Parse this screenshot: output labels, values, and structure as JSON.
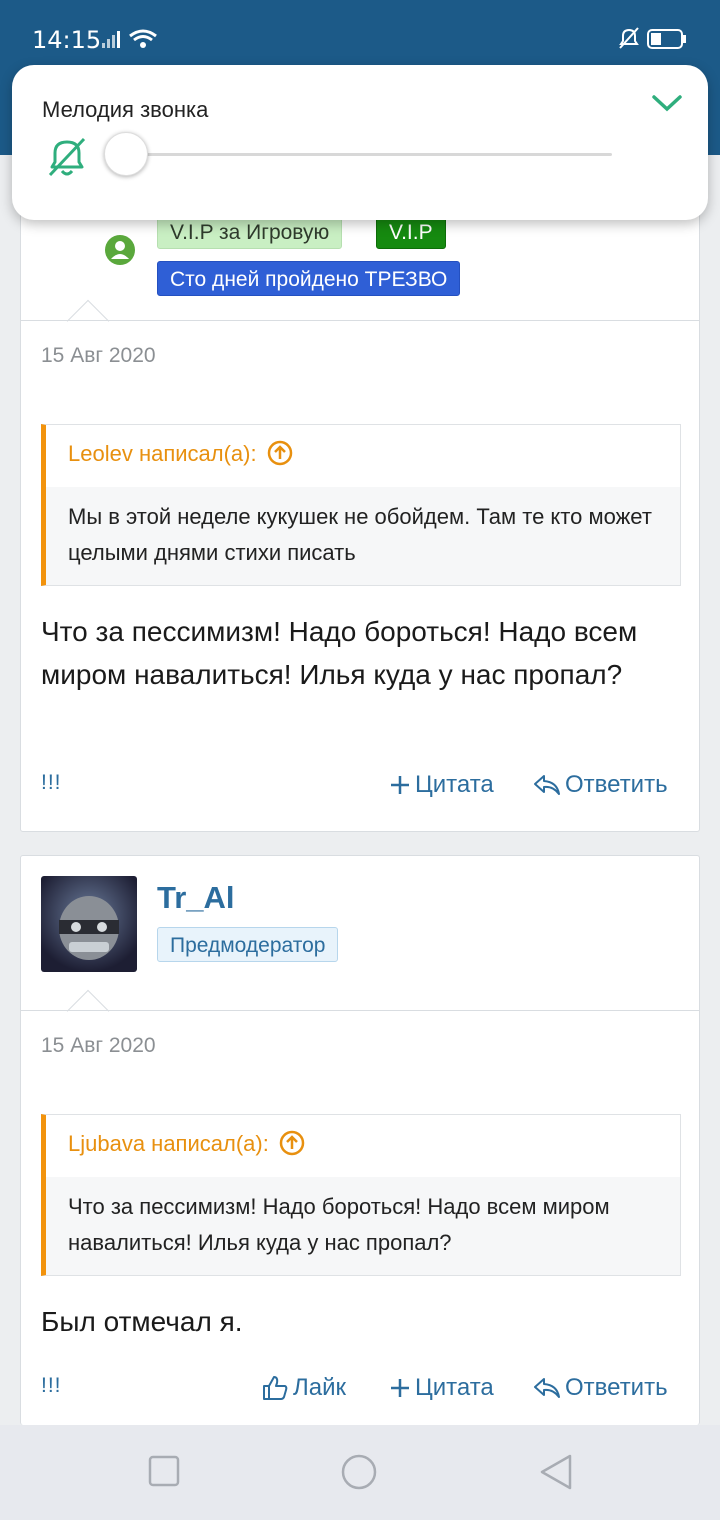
{
  "status_bar": {
    "time": "14:15"
  },
  "ringer": {
    "title": "Мелодия звонка",
    "level": 0
  },
  "posts": [
    {
      "badges": {
        "vip_game": "V.I.P за Игровую",
        "vip": "V.I.P",
        "sober": "Сто дней пройдено ТРЕЗВО"
      },
      "date": "15 Авг 2020",
      "quote": {
        "author": "Leolev написал(а):",
        "text": "Мы в этой неделе кукушек не обойдем. Там те кто может целыми днями стихи писать"
      },
      "message": "Что за пессимизм! Надо бороться! Надо всем миром навалиться! Илья куда у нас пропал?",
      "report": "!!!",
      "quote_action": "Цитата",
      "reply_action": "Ответить"
    },
    {
      "username": "Tr_Al",
      "badge": "Предмодератор",
      "date": "15 Авг 2020",
      "quote": {
        "author": "Ljubava написал(а):",
        "text": "Что за пессимизм! Надо бороться! Надо всем миром навалиться! Илья куда у нас пропал?"
      },
      "message": "Был отмечал я.",
      "report": "!!!",
      "like_action": "Лайк",
      "quote_action": "Цитата",
      "reply_action": "Ответить"
    }
  ]
}
